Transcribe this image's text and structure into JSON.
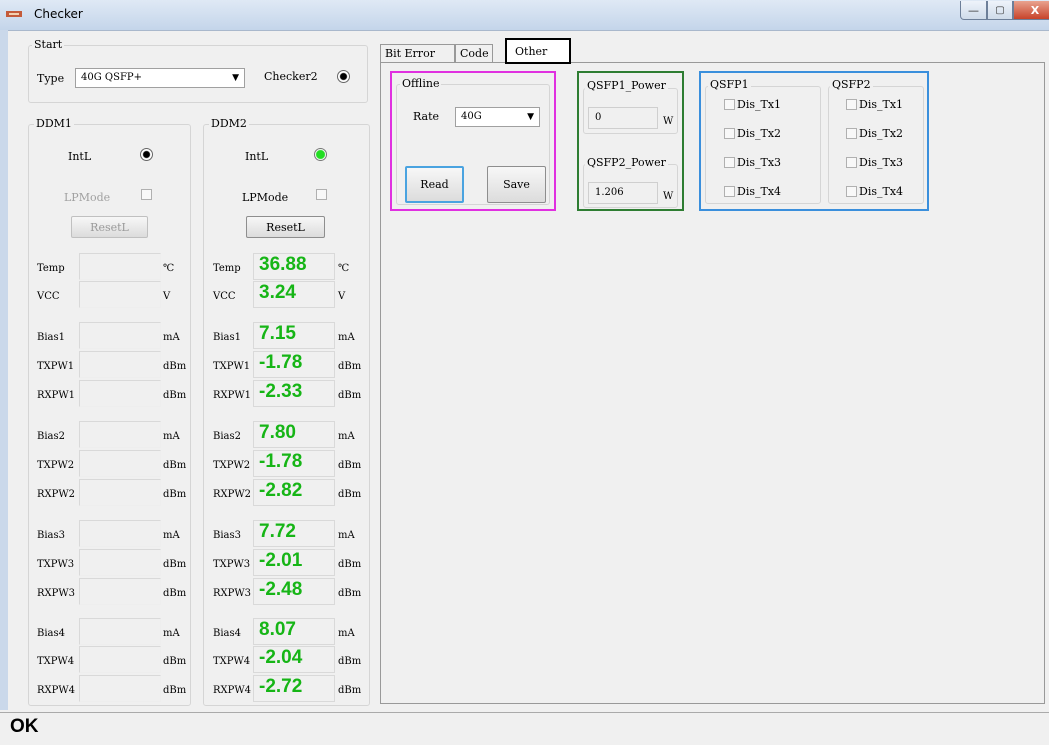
{
  "window": {
    "title": "Checker",
    "minimize": "—",
    "maximize": "▢",
    "close": "X"
  },
  "start": {
    "label": "Start",
    "type_label": "Type",
    "type_value": "40G QSFP+",
    "checker2_label": "Checker2"
  },
  "ddm1": {
    "label": "DDM1",
    "intl": "IntL",
    "lpmode": "LPMode",
    "resetl": "ResetL",
    "rows": [
      {
        "label": "Temp",
        "unit": "℃"
      },
      {
        "label": "VCC",
        "unit": "V"
      },
      {
        "label": "Bias1",
        "unit": "mA"
      },
      {
        "label": "TXPW1",
        "unit": "dBm"
      },
      {
        "label": "RXPW1",
        "unit": "dBm"
      },
      {
        "label": "Bias2",
        "unit": "mA"
      },
      {
        "label": "TXPW2",
        "unit": "dBm"
      },
      {
        "label": "RXPW2",
        "unit": "dBm"
      },
      {
        "label": "Bias3",
        "unit": "mA"
      },
      {
        "label": "TXPW3",
        "unit": "dBm"
      },
      {
        "label": "RXPW3",
        "unit": "dBm"
      },
      {
        "label": "Bias4",
        "unit": "mA"
      },
      {
        "label": "TXPW4",
        "unit": "dBm"
      },
      {
        "label": "RXPW4",
        "unit": "dBm"
      }
    ]
  },
  "ddm2": {
    "label": "DDM2",
    "intl": "IntL",
    "lpmode": "LPMode",
    "resetl": "ResetL",
    "rows": [
      {
        "label": "Temp",
        "value": "36.88",
        "unit": "℃"
      },
      {
        "label": "VCC",
        "value": "3.24",
        "unit": "V"
      },
      {
        "label": "Bias1",
        "value": "7.15",
        "unit": "mA"
      },
      {
        "label": "TXPW1",
        "value": "-1.78",
        "unit": "dBm"
      },
      {
        "label": "RXPW1",
        "value": "-2.33",
        "unit": "dBm"
      },
      {
        "label": "Bias2",
        "value": "7.80",
        "unit": "mA"
      },
      {
        "label": "TXPW2",
        "value": "-1.78",
        "unit": "dBm"
      },
      {
        "label": "RXPW2",
        "value": "-2.82",
        "unit": "dBm"
      },
      {
        "label": "Bias3",
        "value": "7.72",
        "unit": "mA"
      },
      {
        "label": "TXPW3",
        "value": "-2.01",
        "unit": "dBm"
      },
      {
        "label": "RXPW3",
        "value": "-2.48",
        "unit": "dBm"
      },
      {
        "label": "Bias4",
        "value": "8.07",
        "unit": "mA"
      },
      {
        "label": "TXPW4",
        "value": "-2.04",
        "unit": "dBm"
      },
      {
        "label": "RXPW4",
        "value": "-2.72",
        "unit": "dBm"
      }
    ]
  },
  "tabs": [
    "Bit Error",
    "Code",
    "Other"
  ],
  "offline": {
    "label": "Offline",
    "rate_label": "Rate",
    "rate_value": "40G",
    "read": "Read",
    "save": "Save"
  },
  "power": {
    "qsfp1_label": "QSFP1_Power",
    "qsfp1_value": "0",
    "qsfp1_unit": "W",
    "qsfp2_label": "QSFP2_Power",
    "qsfp2_value": "1.206",
    "qsfp2_unit": "W"
  },
  "qsfp1": {
    "label": "QSFP1",
    "items": [
      "Dis_Tx1",
      "Dis_Tx2",
      "Dis_Tx3",
      "Dis_Tx4"
    ]
  },
  "qsfp2": {
    "label": "QSFP2",
    "items": [
      "Dis_Tx1",
      "Dis_Tx2",
      "Dis_Tx3",
      "Dis_Tx4"
    ]
  },
  "status": "OK",
  "colors": {
    "value_green": "#16b516",
    "offline_border": "#e030e0",
    "power_border": "#2e7d32",
    "dis_border": "#3a8fdc"
  }
}
